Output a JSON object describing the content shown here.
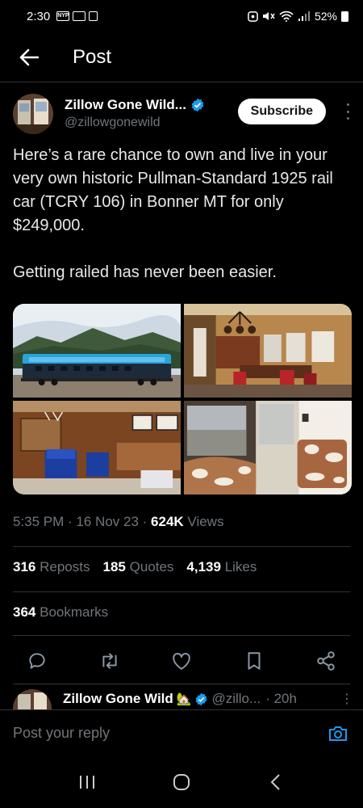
{
  "status_bar": {
    "time": "2:30",
    "left_icons": [
      "nyp-icon",
      "gallery-icon",
      "device-icon"
    ],
    "battery": "52%"
  },
  "header": {
    "title": "Post"
  },
  "author": {
    "name": "Zillow Gone Wild...",
    "handle": "@zillowgonewild",
    "verified": true,
    "subscribe_label": "Subscribe"
  },
  "tweet": {
    "text_p1": "Here’s a rare chance to own and live in your very own historic Pullman-Standard 1925 rail car (TCRY 106) in Bonner MT for only $249,000.",
    "text_p2": "Getting railed has never been easier.",
    "time": "5:35 PM",
    "date": "16 Nov 23",
    "views_count": "624K",
    "views_label": "Views"
  },
  "media": {
    "image_1": "rail car exterior",
    "image_2": "dining interior",
    "image_3": "lounge interior",
    "image_4": "seating nook"
  },
  "stats": {
    "reposts_count": "316",
    "reposts_label": "Reposts",
    "quotes_count": "185",
    "quotes_label": "Quotes",
    "likes_count": "4,139",
    "likes_label": "Likes",
    "bookmarks_count": "364",
    "bookmarks_label": "Bookmarks"
  },
  "reply_preview": {
    "name": "Zillow Gone Wild",
    "emoji": "🏡",
    "handle": "@zillo...",
    "time": "· 20h"
  },
  "reply_bar": {
    "placeholder": "Post your reply"
  },
  "colors": {
    "background": "#000000",
    "text": "#e7e9ea",
    "muted": "#71767b",
    "accent": "#1d9bf0",
    "divider": "#2f3336"
  }
}
